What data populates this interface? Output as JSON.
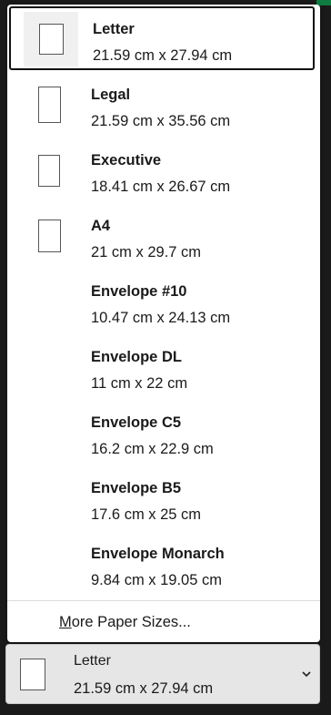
{
  "paper_sizes": {
    "items": [
      {
        "name": "Letter",
        "dims": "21.59 cm x 27.94 cm",
        "icon": "paper-letter-icon",
        "selected": true
      },
      {
        "name": "Legal",
        "dims": "21.59 cm x 35.56 cm",
        "icon": "paper-legal-icon"
      },
      {
        "name": "Executive",
        "dims": "18.41 cm x 26.67 cm",
        "icon": "paper-executive-icon"
      },
      {
        "name": "A4",
        "dims": "21 cm x 29.7 cm",
        "icon": "paper-a4-icon"
      },
      {
        "name": "Envelope #10",
        "dims": "10.47 cm x 24.13 cm"
      },
      {
        "name": "Envelope DL",
        "dims": "11 cm x 22 cm"
      },
      {
        "name": "Envelope C5",
        "dims": "16.2 cm x 22.9 cm"
      },
      {
        "name": "Envelope B5",
        "dims": "17.6 cm x 25 cm"
      },
      {
        "name": "Envelope Monarch",
        "dims": "9.84 cm x 19.05 cm"
      }
    ],
    "more_label_accel": "M",
    "more_label_rest": "ore Paper Sizes..."
  },
  "combo": {
    "name": "Letter",
    "dims": "21.59 cm x 27.94 cm",
    "icon": "paper-letter-icon",
    "chevron_icon": "chevron-down-icon"
  },
  "colors": {
    "accent_green": "#107c41",
    "selected_border": "#111111",
    "combo_background": "#e6e6e6"
  }
}
